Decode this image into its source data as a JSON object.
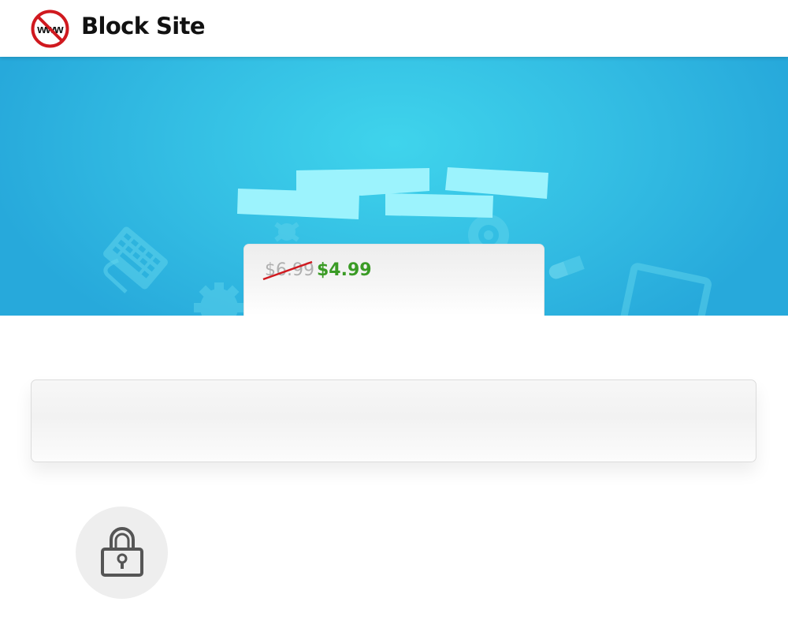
{
  "header": {
    "brand": "Block Site",
    "logo_icon": "no-www-icon",
    "logo_text": "www"
  },
  "hero": {
    "background_icons": [
      "keyboard-icon",
      "gear-icon",
      "webcam-icon",
      "pills-icon",
      "monitor-icon",
      "puzzle-icon"
    ]
  },
  "pricing": {
    "old_price": "$6.99",
    "new_price": "$4.99"
  },
  "feature": {
    "icon": "lock-icon"
  },
  "colors": {
    "hero_blue": "#33bde3",
    "hero_light": "#9cf3fd",
    "new_price_green": "#3a9b25",
    "strike_red": "#d0191f",
    "logo_red": "#d0191f"
  }
}
